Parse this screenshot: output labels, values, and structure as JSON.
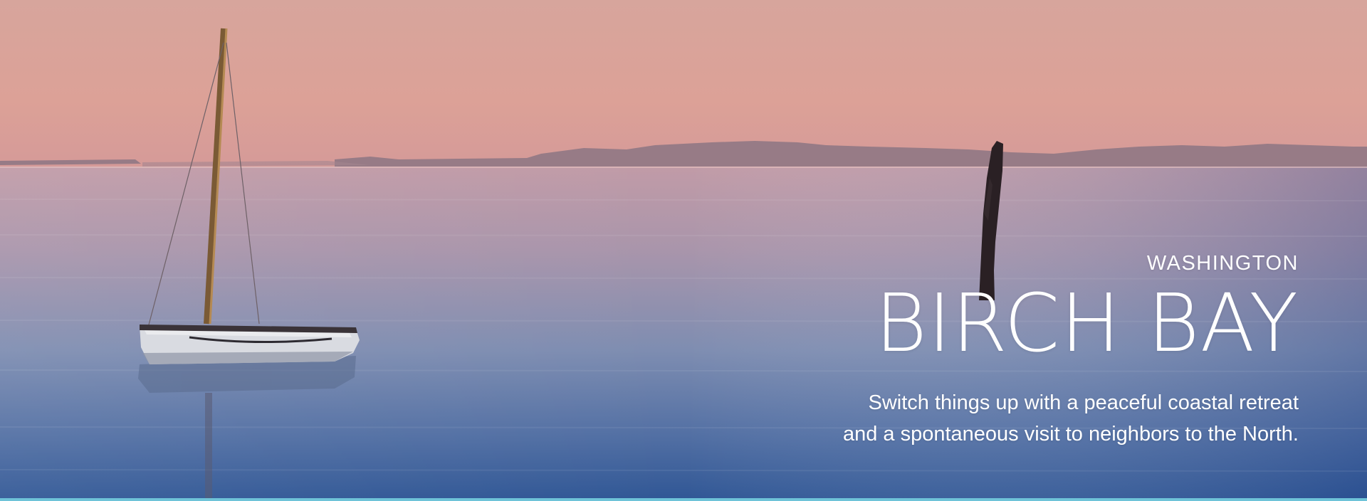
{
  "hero": {
    "eyebrow": "WASHINGTON",
    "title": "BIRCH BAY",
    "subtitle_line1": "Switch things up with a peaceful coastal retreat",
    "subtitle_line2": "and a spontaneous visit to neighbors to the North."
  },
  "colors": {
    "sky_top": "#d7a49a",
    "sky_horizon": "#e2a49a",
    "mountains": "#8f7784",
    "water_top": "#b89aa6",
    "water_mid": "#7f8db0",
    "water_bottom": "#2c5294",
    "accent_strip": "#6ec3d8",
    "text": "#ffffff"
  }
}
